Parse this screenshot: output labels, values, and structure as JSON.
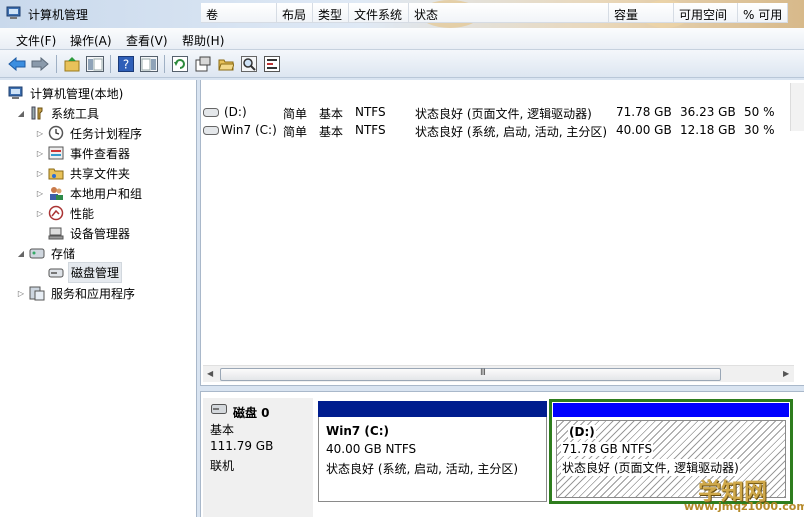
{
  "window": {
    "title": "计算机管理"
  },
  "menu": [
    "文件(F)",
    "操作(A)",
    "查看(V)",
    "帮助(H)"
  ],
  "toolbar_icons": [
    "back-arrow-icon",
    "forward-arrow-icon",
    "up-folder-icon",
    "show-hide-tree-icon",
    "help-icon",
    "action-pane-icon",
    "refresh-icon",
    "properties-icon",
    "open-folder-icon",
    "search-icon",
    "settings-icon"
  ],
  "tree": [
    {
      "label": "计算机管理(本地)",
      "icon": "computer-management-icon",
      "expander": ""
    },
    {
      "label": "系统工具",
      "icon": "system-tools-icon",
      "expander": "◢"
    },
    {
      "label": "任务计划程序",
      "icon": "clock-icon",
      "expander": "▷"
    },
    {
      "label": "事件查看器",
      "icon": "event-viewer-icon",
      "expander": "▷"
    },
    {
      "label": "共享文件夹",
      "icon": "shared-folder-icon",
      "expander": "▷"
    },
    {
      "label": "本地用户和组",
      "icon": "users-icon",
      "expander": "▷"
    },
    {
      "label": "性能",
      "icon": "performance-icon",
      "expander": "▷"
    },
    {
      "label": "设备管理器",
      "icon": "device-manager-icon",
      "expander": ""
    },
    {
      "label": "存储",
      "icon": "storage-icon",
      "expander": "◢"
    },
    {
      "label": "磁盘管理",
      "icon": "disk-icon",
      "expander": ""
    },
    {
      "label": "服务和应用程序",
      "icon": "services-icon",
      "expander": "▷"
    }
  ],
  "columns": [
    "卷",
    "布局",
    "类型",
    "文件系统",
    "状态",
    "容量",
    "可用空间",
    "% 可用"
  ],
  "volumes": [
    {
      "name": "(D:)",
      "layout": "简单",
      "type": "基本",
      "fs": "NTFS",
      "status": "状态良好 (页面文件, 逻辑驱动器)",
      "capacity": "71.78 GB",
      "free": "36.23 GB",
      "pct": "50 %"
    },
    {
      "name": "Win7 (C:)",
      "layout": "简单",
      "type": "基本",
      "fs": "NTFS",
      "status": "状态良好 (系统, 启动, 活动, 主分区)",
      "capacity": "40.00 GB",
      "free": "12.18 GB",
      "pct": "30 %"
    }
  ],
  "scroll_grip": "III",
  "disk": {
    "name": "磁盘 0",
    "type": "基本",
    "size": "111.79 GB",
    "state": "联机"
  },
  "partitions": {
    "c": {
      "name": "Win7  (C:)",
      "info": "40.00 GB NTFS",
      "status": "状态良好 (系统, 启动, 活动, 主分区)"
    },
    "d": {
      "name": "(D:)",
      "info": "71.78 GB NTFS",
      "status": "状态良好 (页面文件, 逻辑驱动器)"
    }
  },
  "watermark": {
    "main": "学知网",
    "sub": "www.jmqz1000.com"
  },
  "colors": {
    "primary_partition_bar": "#001d8e",
    "logical_partition_bar": "#0000ff",
    "selection_border": "#2e7d1e"
  }
}
